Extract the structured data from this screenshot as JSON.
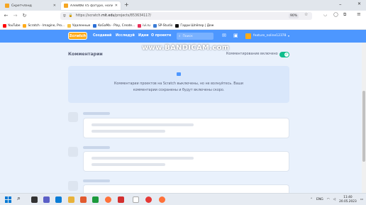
{
  "browser": {
    "tabs": [
      {
        "label": "Скретчлэнд",
        "active": false,
        "color": "#f5a623"
      },
      {
        "label": "АлеВФВ V5 фатуре, нолинс",
        "active": true,
        "color": "#f5a623"
      }
    ],
    "new_tab_symbol": "+",
    "url_prefix": "https://scratch.",
    "url_host": "mit.edu",
    "url_path": "/projects/853634117/",
    "zoom": "90%",
    "bookmarks": [
      {
        "label": "YouTube",
        "color": "#ff0000"
      },
      {
        "label": "Scratch - Imagine, Pro...",
        "color": "#ffab19"
      },
      {
        "label": "Удаленные",
        "color": "#f5c242"
      },
      {
        "label": "KoGaMa - Play, Create...",
        "color": "#2b6fd6"
      },
      {
        "label": "ivi.ru",
        "color": "#e8305a"
      },
      {
        "label": "SP-Studio",
        "color": "#3a7bd5"
      },
      {
        "label": "Гарри Шпёпер | Деж",
        "color": "#111111"
      }
    ]
  },
  "watermark": "www.BANDICAM.com",
  "scratch": {
    "logo": "Scratch",
    "nav": [
      "Создавай",
      "Исследуй",
      "Идеи",
      "О проекте"
    ],
    "search_placeholder": "Поиск",
    "username": "feature_noline12378"
  },
  "comments": {
    "title": "Комментарии",
    "toggle_label": "Комментирование включено",
    "toggle_on": true,
    "notice_line1": "Комментарии проектов на Scratch выключены, но не волнуйтесь. Ваши",
    "notice_line2": "комментарии сохранены и будут включены скоро."
  },
  "taskbar": {
    "lang": "ENG",
    "time": "11:40",
    "date": "20.05.2023"
  }
}
